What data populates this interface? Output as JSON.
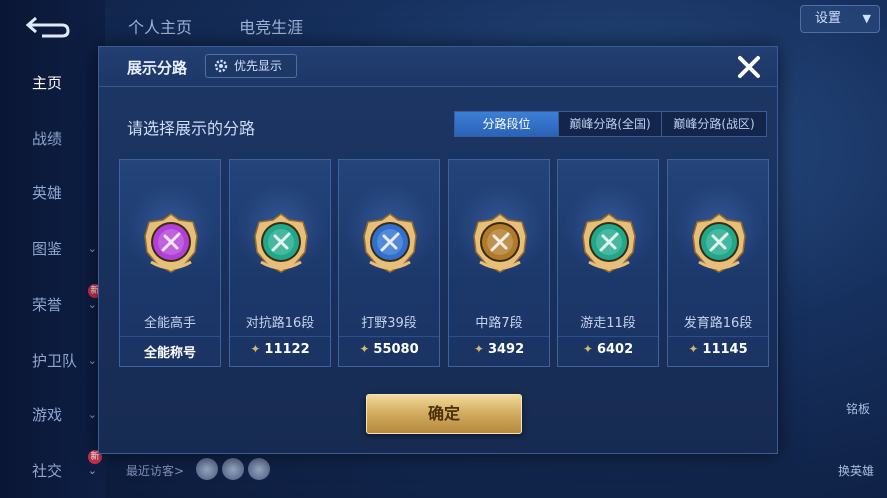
{
  "background": {
    "nav_items": [
      {
        "label": "主页",
        "active": true,
        "has_chevron": false
      },
      {
        "label": "战绩",
        "active": false,
        "has_chevron": false
      },
      {
        "label": "英雄",
        "active": false,
        "has_chevron": false
      },
      {
        "label": "图鉴",
        "active": false,
        "has_chevron": true
      },
      {
        "label": "荣誉",
        "active": false,
        "has_chevron": true,
        "badge": "新"
      },
      {
        "label": "护卫队",
        "active": false,
        "has_chevron": true
      },
      {
        "label": "游戏",
        "active": false,
        "has_chevron": true
      },
      {
        "label": "社交",
        "active": false,
        "has_chevron": true,
        "badge": "新"
      }
    ],
    "top_tabs": [
      "个人主页",
      "电竞生涯"
    ],
    "settings_label": "设置",
    "recent_visitors_label": "最近访客>",
    "right_labels": [
      "铭板",
      "换英雄"
    ]
  },
  "dialog": {
    "title": "展示分路",
    "priority_label": "优先显示",
    "subtitle": "请选择展示的分路",
    "tabs": [
      {
        "label": "分路段位",
        "active": true
      },
      {
        "label": "巅峰分路(全国)",
        "active": false
      },
      {
        "label": "巅峰分路(战区)",
        "active": false
      }
    ],
    "cards": [
      {
        "name": "全能高手",
        "score": "全能称号",
        "icon": "all-round-emblem-icon",
        "color": "#b23fd6",
        "show_points": false
      },
      {
        "name": "对抗路16段",
        "score": "11122",
        "icon": "clash-lane-emblem-icon",
        "color": "#1fa98a",
        "show_points": true
      },
      {
        "name": "打野39段",
        "score": "55080",
        "icon": "jungle-emblem-icon",
        "color": "#2f6fd0",
        "show_points": true
      },
      {
        "name": "中路7段",
        "score": "3492",
        "icon": "mid-lane-emblem-icon",
        "color": "#b07a2a",
        "show_points": true
      },
      {
        "name": "游走11段",
        "score": "6402",
        "icon": "roam-emblem-icon",
        "color": "#1fa98a",
        "show_points": true
      },
      {
        "name": "发育路16段",
        "score": "11145",
        "icon": "farm-lane-emblem-icon",
        "color": "#1fa98a",
        "show_points": true
      }
    ],
    "confirm_label": "确定"
  }
}
